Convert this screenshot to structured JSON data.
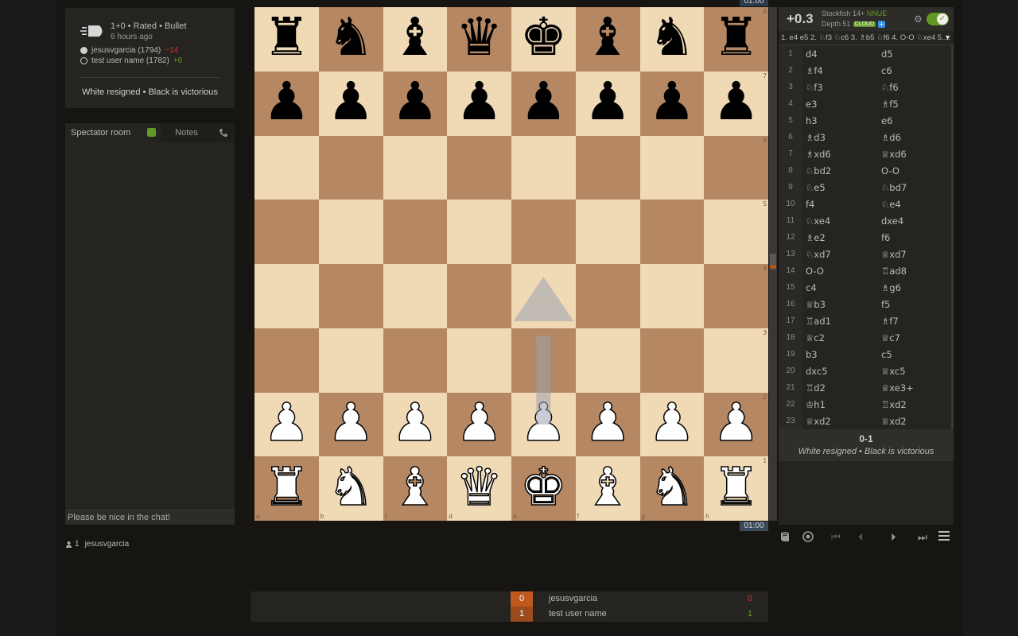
{
  "game": {
    "type": "1+0 • Rated • Bullet",
    "ago": "6 hours ago",
    "white_player": "jesusvgarcia (1794)",
    "white_diff": "−14",
    "black_player": "test user name (1782)",
    "black_diff": "+6",
    "status": "White resigned • Black is victorious"
  },
  "chat": {
    "tab_spectator": "Spectator room",
    "tab_notes": "Notes",
    "placeholder": "Please be nice in the chat!",
    "watchers_count": "1",
    "watcher": "jesusvgarcia"
  },
  "clocks": {
    "top": "01:00",
    "bottom": "01:00"
  },
  "board": {
    "ranks": [
      "8",
      "7",
      "6",
      "5",
      "4",
      "3",
      "2",
      "1"
    ],
    "files": [
      "a",
      "b",
      "c",
      "d",
      "e",
      "f",
      "g",
      "h"
    ],
    "pieces": [
      [
        "bR",
        "bN",
        "bB",
        "bQ",
        "bK",
        "bB",
        "bN",
        "bR"
      ],
      [
        "bP",
        "bP",
        "bP",
        "bP",
        "bP",
        "bP",
        "bP",
        "bP"
      ],
      [
        "",
        "",
        "",
        "",
        "",
        "",
        "",
        ""
      ],
      [
        "",
        "",
        "",
        "",
        "",
        "",
        "",
        ""
      ],
      [
        "",
        "",
        "",
        "",
        "",
        "",
        "",
        ""
      ],
      [
        "",
        "",
        "",
        "",
        "",
        "",
        "",
        ""
      ],
      [
        "wP",
        "wP",
        "wP",
        "wP",
        "wP",
        "wP",
        "wP",
        "wP"
      ],
      [
        "wR",
        "wN",
        "wB",
        "wQ",
        "wK",
        "wB",
        "wN",
        "wR"
      ]
    ],
    "arrow": {
      "from": "e2",
      "to": "e4",
      "color": "#9ca3b0"
    }
  },
  "engine": {
    "eval": "+0.3",
    "name": "Stockfish 14+",
    "nnue": "NNUE",
    "depth": "Depth 51",
    "cloud": "CLOUD",
    "plus": "+",
    "pv": "1. e4 e5 2. ♘f3 ♘c6 3. ♗b5 ♘f6 4. O-O ♘xe4 5...."
  },
  "moves": [
    [
      "1",
      "d4",
      "d5"
    ],
    [
      "2",
      "♗f4",
      "c6"
    ],
    [
      "3",
      "♘f3",
      "♘f6"
    ],
    [
      "4",
      "e3",
      "♗f5"
    ],
    [
      "5",
      "h3",
      "e6"
    ],
    [
      "6",
      "♗d3",
      "♗d6"
    ],
    [
      "7",
      "♗xd6",
      "♕xd6"
    ],
    [
      "8",
      "♘bd2",
      "O-O"
    ],
    [
      "9",
      "♘e5",
      "♘bd7"
    ],
    [
      "10",
      "f4",
      "♘e4"
    ],
    [
      "11",
      "♘xe4",
      "dxe4"
    ],
    [
      "12",
      "♗e2",
      "f6"
    ],
    [
      "13",
      "♘xd7",
      "♕xd7"
    ],
    [
      "14",
      "O-O",
      "♖ad8"
    ],
    [
      "15",
      "c4",
      "♗g6"
    ],
    [
      "16",
      "♕b3",
      "f5"
    ],
    [
      "17",
      "♖ad1",
      "♗f7"
    ],
    [
      "18",
      "♕c2",
      "♕c7"
    ],
    [
      "19",
      "b3",
      "c5"
    ],
    [
      "20",
      "dxc5",
      "♕xc5"
    ],
    [
      "21",
      "♖d2",
      "♕xe3+"
    ],
    [
      "22",
      "♔h1",
      "♖xd2"
    ],
    [
      "23",
      "♕xd2",
      "♕xd2"
    ]
  ],
  "result": {
    "score": "0-1",
    "text": "White resigned • Black is victorious"
  },
  "players": {
    "white": {
      "score_box": "0",
      "name": "jesusvgarcia",
      "score": "0"
    },
    "black": {
      "score_box": "1",
      "name": "test user name",
      "score": "1"
    }
  },
  "colors": {
    "accent": "#629924",
    "negative": "#cc3333",
    "light_square": "#f0d9b5",
    "dark_square": "#b58863"
  }
}
